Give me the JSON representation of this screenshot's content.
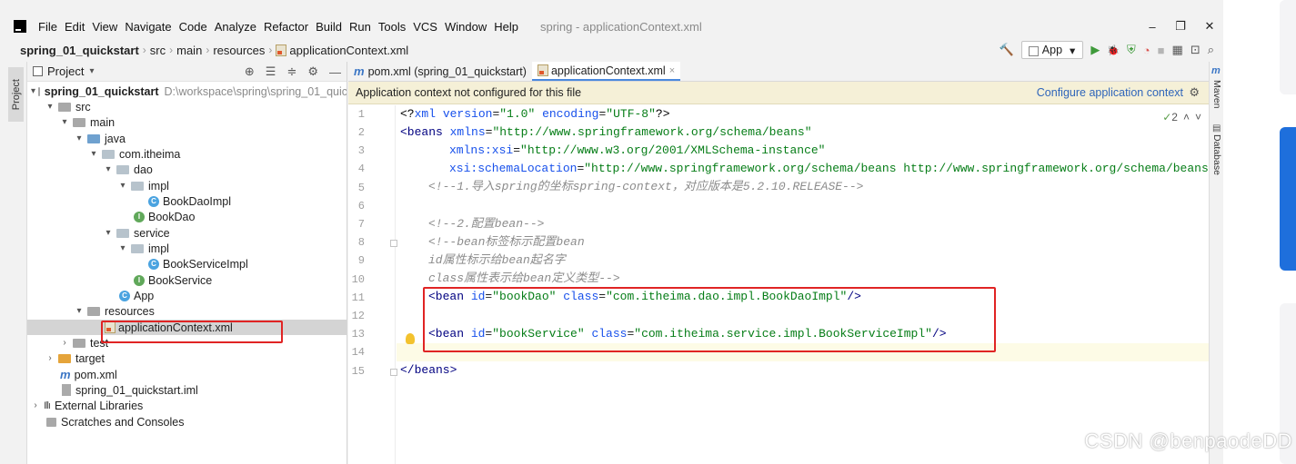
{
  "menu": {
    "items": [
      "File",
      "Edit",
      "View",
      "Navigate",
      "Code",
      "Analyze",
      "Refactor",
      "Build",
      "Run",
      "Tools",
      "VCS",
      "Window",
      "Help"
    ],
    "window_title": "spring - applicationContext.xml",
    "minimize": "–",
    "maximize": "❐",
    "close": "✕"
  },
  "breadcrumb": {
    "project": "spring_01_quickstart",
    "src": "src",
    "main": "main",
    "resources": "resources",
    "file": "applicationContext.xml",
    "sep": "›"
  },
  "toolbar": {
    "run_config": "App",
    "dropdown_arrow": "▾",
    "build_icon": "🔨",
    "run_icon": "▶",
    "debug_icon": "🐞",
    "coverage_icon": "⛨",
    "profile_icon": "◔",
    "stop_icon": "■",
    "structure_icon": "▦",
    "layout_icon": "⊡",
    "search_icon": "⌕"
  },
  "left_strip": {
    "project_tab": "Project"
  },
  "right_strip": {
    "maven": "Maven",
    "database": "Database"
  },
  "project_panel": {
    "title": "Project",
    "title_arrow": "▾",
    "locate_icon": "⊕",
    "expand_icon": "☰",
    "collapse_icon": "≑",
    "gear_icon": "⚙",
    "hide_icon": "—",
    "tree": [
      {
        "label": "spring_01_quickstart",
        "extra": "D:\\workspace\\spring\\spring_01_quic",
        "arrow": "▾"
      },
      {
        "label": "src",
        "arrow": "▾"
      },
      {
        "label": "main",
        "arrow": "▾"
      },
      {
        "label": "java",
        "arrow": "▾"
      },
      {
        "label": "com.itheima",
        "arrow": "▾"
      },
      {
        "label": "dao",
        "arrow": "▾"
      },
      {
        "label": "impl",
        "arrow": "▾"
      },
      {
        "label": "BookDaoImpl",
        "icon": "C"
      },
      {
        "label": "BookDao",
        "icon": "I"
      },
      {
        "label": "service",
        "arrow": "▾"
      },
      {
        "label": "impl",
        "arrow": "▾"
      },
      {
        "label": "BookServiceImpl",
        "icon": "C"
      },
      {
        "label": "BookService",
        "icon": "I"
      },
      {
        "label": "App",
        "icon": "C"
      },
      {
        "label": "resources",
        "arrow": "▾"
      },
      {
        "label": "applicationContext.xml"
      },
      {
        "label": "test",
        "arrow": "›"
      },
      {
        "label": "target",
        "arrow": "›"
      },
      {
        "label": "pom.xml",
        "icon": "m"
      },
      {
        "label": "spring_01_quickstart.iml"
      },
      {
        "label": "External Libraries",
        "arrow": "›",
        "icon": "Illı"
      },
      {
        "label": "Scratches and Consoles"
      }
    ]
  },
  "editor": {
    "tabs": [
      {
        "label": "pom.xml (spring_01_quickstart)",
        "icon": "m"
      },
      {
        "label": "applicationContext.xml",
        "close": "×"
      }
    ],
    "banner_text": "Application context not configured for this file",
    "banner_link": "Configure application context",
    "banner_gear": "⚙",
    "warnings": "2",
    "warn_check": "✓",
    "warn_up": "˄",
    "warn_down": "˅",
    "line_numbers": [
      "1",
      "2",
      "3",
      "4",
      "5",
      "6",
      "7",
      "8",
      "9",
      "10",
      "11",
      "12",
      "13",
      "14",
      "15"
    ],
    "lines": {
      "l1": {
        "a": "<?",
        "b": "xml version",
        "c": "=",
        "d": "\"1.0\"",
        "e": " encoding",
        "f": "=",
        "g": "\"UTF-8\"",
        "h": "?>"
      },
      "l2": {
        "a": "<beans ",
        "b": "xmlns",
        "c": "=",
        "d": "\"http://www.springframework.org/schema/beans\""
      },
      "l3": {
        "b": "xmlns:xsi",
        "c": "=",
        "d": "\"http://www.w3.org/2001/XMLSchema-instance\""
      },
      "l4": {
        "b": "xsi:schemaLocation",
        "c": "=",
        "d": "\"http://www.springframework.org/schema/beans http://www.springframework.org/schema/beans/s"
      },
      "l5": "<!--1.导入spring的坐标spring-context，对应版本是5.2.10.RELEASE-->",
      "l7": "<!--2.配置bean-->",
      "l8": "<!--bean标签标示配置bean",
      "l9": "id属性标示给bean起名字",
      "l10": "class属性表示给bean定义类型-->",
      "l11": {
        "a": "<bean ",
        "b": "id",
        "c": "=",
        "d": "\"bookDao\"",
        "e": " class",
        "f": "=",
        "g": "\"com.itheima.dao.impl.BookDaoImpl\"",
        "h": "/>"
      },
      "l13": {
        "a": "<bean ",
        "b": "id",
        "c": "=",
        "d": "\"bookService\"",
        "e": " class",
        "f": "=",
        "g": "\"com.itheima.service.impl.BookServiceImpl\"",
        "h": "/>"
      },
      "l15": "</beans>"
    }
  },
  "watermark": "CSDN @benpaodeDD",
  "colors": {
    "annotation_red": "#e02424",
    "banner_bg": "#f5f0d7",
    "link_blue": "#2f65ba",
    "xml_tag": "#000080",
    "xml_attr": "#1750eb",
    "xml_value": "#067d17",
    "comment": "#8c8c8c"
  }
}
